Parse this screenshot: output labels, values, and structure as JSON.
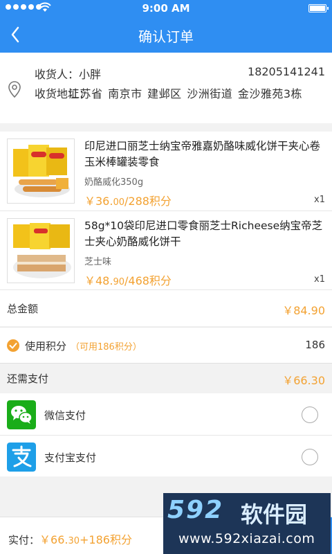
{
  "status_bar": {
    "time": "9:00 AM"
  },
  "nav": {
    "title": "确认订单",
    "back_icon": "chevron-left-icon"
  },
  "address": {
    "recipient_label": "收货人：",
    "recipient_name": "小胖",
    "phone": "18205141241",
    "address_label": "收货地址：",
    "address_value": "江苏省 南京市 建邺区 沙洲街道 金沙雅苑3栋",
    "icon": "location-pin-icon"
  },
  "products": [
    {
      "name": "印尼进口丽芝士纳宝帝雅嘉奶酪味威化饼干夹心卷玉米棒罐装零食",
      "spec": "奶酪威化350g",
      "price_main": "￥36.",
      "price_cents": "00",
      "price_points": "/288积分",
      "qty": "x1"
    },
    {
      "name": "58g*10袋印尼进口零食丽芝士Richeese纳宝帝芝士夹心奶酪威化饼干",
      "spec": "芝士味",
      "price_main": "￥48.",
      "price_cents": "90",
      "price_points": "/468积分",
      "qty": "x1"
    }
  ],
  "summary": {
    "total_label": "总金额",
    "total_value": "￥84.90",
    "points_label": "使用积分",
    "points_available": "（可用186积分）",
    "points_value": "186",
    "due_label": "还需支付",
    "due_value": "￥66.30"
  },
  "payment": {
    "wechat_label": "微信支付",
    "alipay_label": "支付宝支付"
  },
  "footer": {
    "label": "实付：",
    "amount_main": "￥66.",
    "amount_cents": "30",
    "amount_points": "+186积分"
  },
  "watermark": {
    "logo": "592",
    "text_cn": "软件园",
    "url": "www.592xiazai.com"
  },
  "colors": {
    "brand_blue": "#2f8ef2",
    "price_orange": "#f3a232",
    "wechat_green": "#1aad19",
    "alipay_blue": "#1e9fe8"
  }
}
